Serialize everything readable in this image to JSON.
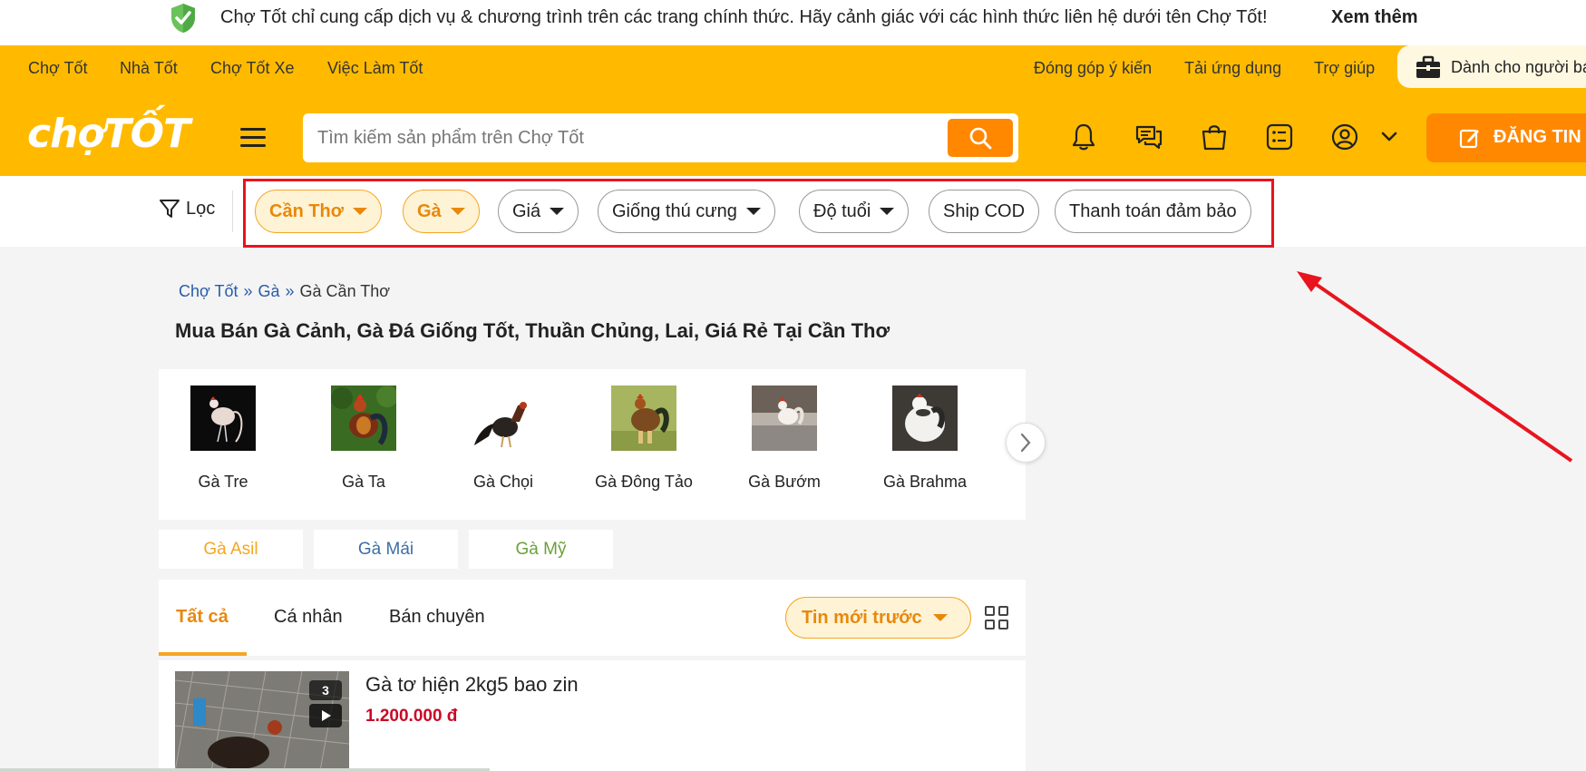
{
  "notice": {
    "text": "Chợ Tốt chỉ cung cấp dịch vụ & chương trình trên các trang chính thức. Hãy cảnh giác với các hình thức liên hệ dưới tên Chợ Tốt!",
    "link": "Xem thêm"
  },
  "topbar": {
    "left_links": [
      "Chợ Tốt",
      "Nhà Tốt",
      "Chợ Tốt Xe",
      "Việc Làm Tốt"
    ],
    "right_links": [
      "Đóng góp ý kiến",
      "Tải ứng dụng",
      "Trợ giúp"
    ],
    "seller": "Dành cho người bá"
  },
  "header": {
    "logo": "chợTỐT",
    "search_placeholder": "Tìm kiếm sản phẩm trên Chợ Tốt",
    "post_button": "ĐĂNG TIN"
  },
  "filters": {
    "label": "Lọc",
    "chips": [
      "Cần Thơ",
      "Gà",
      "Giá",
      "Giống thú cưng",
      "Độ tuổi",
      "Ship COD",
      "Thanh toán đảm bảo"
    ]
  },
  "breadcrumb": [
    "Chợ Tốt",
    "Gà",
    "Gà Cần Thơ"
  ],
  "page_title": "Mua Bán Gà Cảnh, Gà Đá Giống Tốt, Thuần Chủng, Lai, Giá Rẻ Tại Cần Thơ",
  "categories": [
    "Gà Tre",
    "Gà Ta",
    "Gà Chọi",
    "Gà Đông Tảo",
    "Gà Bướm",
    "Gà Brahma"
  ],
  "tags": [
    {
      "label": "Gà Asil",
      "color": "#f5a623"
    },
    {
      "label": "Gà Mái",
      "color": "#3d6ea6"
    },
    {
      "label": "Gà Mỹ",
      "color": "#6aa13a"
    }
  ],
  "tabs": [
    "Tất cả",
    "Cá nhân",
    "Bán chuyên"
  ],
  "sort": "Tin mới trước",
  "listing": {
    "title": "Gà tơ hiện 2kg5 bao zin",
    "price": "1.200.000 đ",
    "image_count": "3"
  },
  "colors": {
    "brand": "#ffba00",
    "accent": "#ff8800",
    "highlight_box": "#e8141e",
    "price": "#c90927"
  }
}
